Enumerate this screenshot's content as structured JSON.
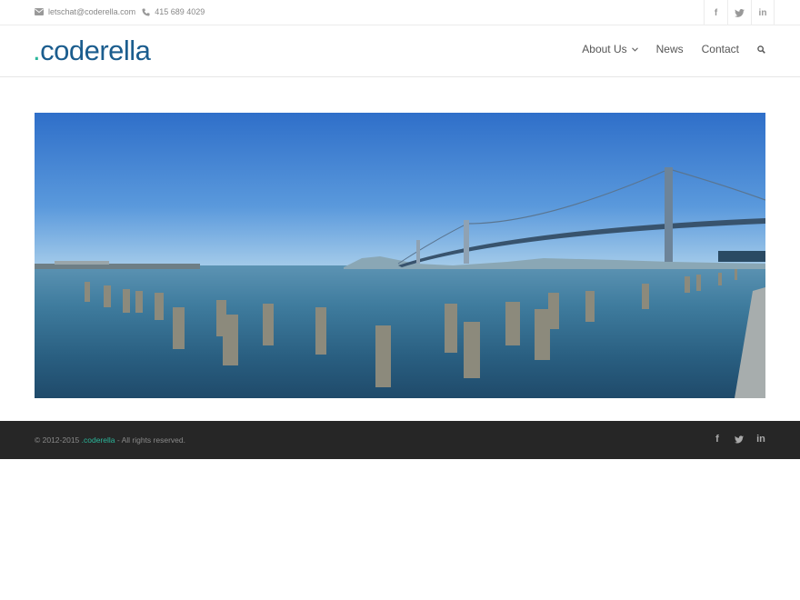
{
  "topbar": {
    "email": "letschat@coderella.com",
    "phone": "415 689 4029",
    "social": [
      {
        "name": "facebook-icon",
        "glyph": "f"
      },
      {
        "name": "twitter-icon",
        "glyph": "t"
      },
      {
        "name": "linkedin-icon",
        "glyph": "in"
      }
    ]
  },
  "header": {
    "logo_dot": ".",
    "logo_text": "coderella",
    "nav": {
      "about": "About Us",
      "news": "News",
      "contact": "Contact"
    }
  },
  "hero": {
    "icons": [
      "bridge-photo"
    ]
  },
  "footer": {
    "copy_prefix": "© 2012-2015 ",
    "brand": ".coderella",
    "copy_suffix": " - All rights reserved.",
    "social": [
      {
        "name": "facebook-icon",
        "glyph": "f"
      },
      {
        "name": "twitter-icon",
        "glyph": "t"
      },
      {
        "name": "linkedin-icon",
        "glyph": "in"
      }
    ]
  },
  "colors": {
    "brand_blue": "#1b5d8e",
    "brand_teal": "#2bb79b",
    "footer_bg": "#262626"
  }
}
